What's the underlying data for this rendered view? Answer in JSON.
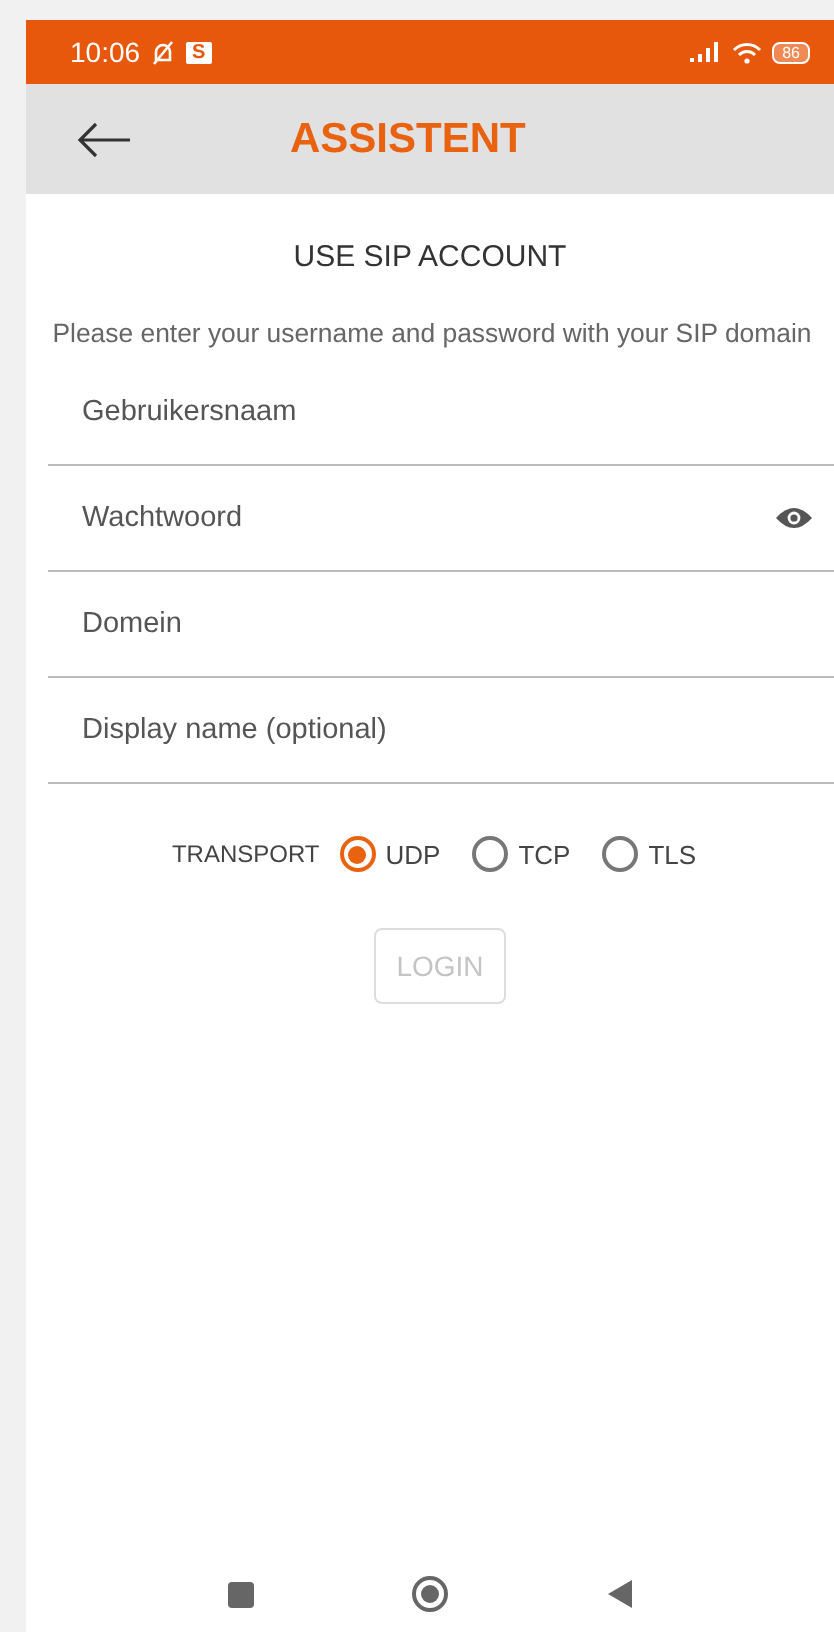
{
  "status_bar": {
    "time": "10:06",
    "notification": "S",
    "battery": "86"
  },
  "toolbar": {
    "title": "ASSISTENT"
  },
  "heading": "USE SIP ACCOUNT",
  "description": "Please enter your username and password with your SIP domain",
  "fields": [
    {
      "placeholder": "Gebruikersnaam",
      "kind": "text"
    },
    {
      "placeholder": "Wachtwoord",
      "kind": "password"
    },
    {
      "placeholder": "Domein",
      "kind": "text"
    },
    {
      "placeholder": "Display name (optional)",
      "kind": "text"
    }
  ],
  "transport": {
    "label": "TRANSPORT",
    "options": [
      {
        "label": "UDP",
        "selected": true
      },
      {
        "label": "TCP",
        "selected": false
      },
      {
        "label": "TLS",
        "selected": false
      }
    ]
  },
  "login_button": {
    "label": "LOGIN",
    "disabled": true
  }
}
